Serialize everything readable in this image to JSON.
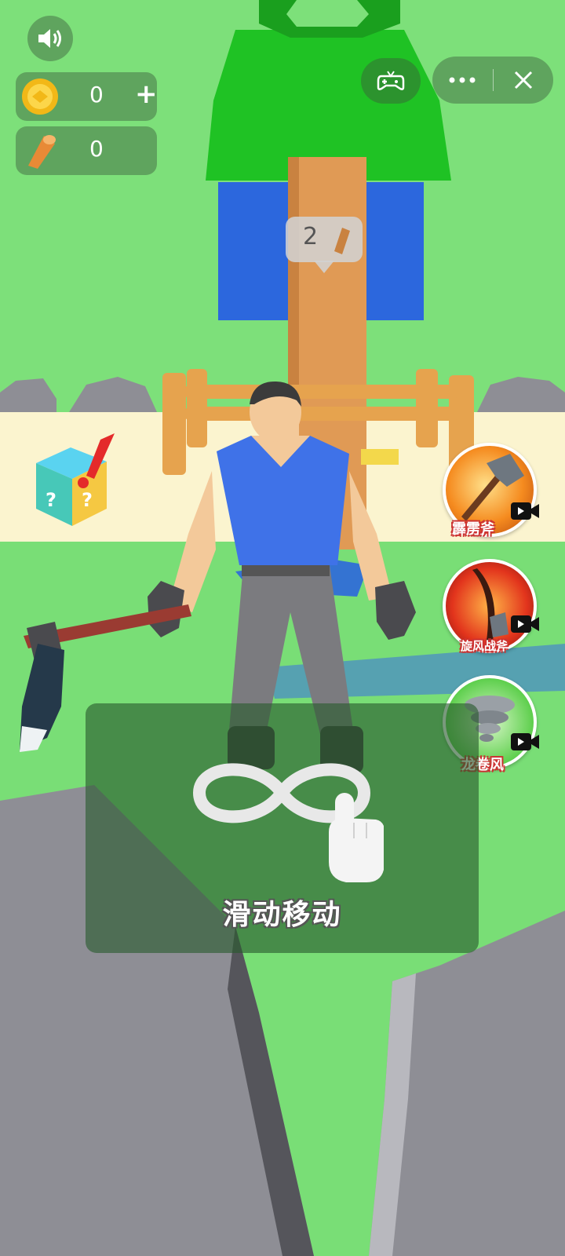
{
  "hud": {
    "coins": "0",
    "wood": "0",
    "add_label": "+"
  },
  "tree": {
    "wood_required": "2"
  },
  "skills": [
    {
      "name": "霹雳斧",
      "icon": "axe-icon"
    },
    {
      "name": "旋风战斧",
      "icon": "flame-axe-icon"
    },
    {
      "name": "龙卷风",
      "icon": "tornado-icon"
    }
  ],
  "tutorial": {
    "text": "滑动移动",
    "icon": "infinity-swipe-icon"
  },
  "colors": {
    "grass": "#7de07a",
    "sand": "#fbf4cf",
    "rock": "#8e8e95",
    "shirt": "#3f72e8"
  }
}
